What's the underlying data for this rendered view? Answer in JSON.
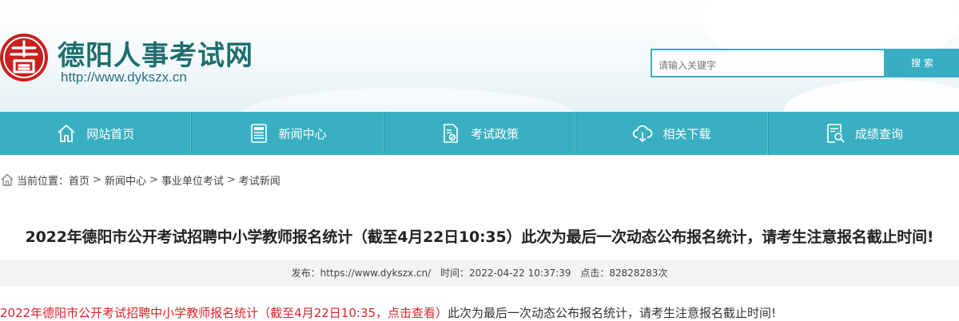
{
  "header": {
    "site_name": "德阳人事考试网",
    "site_url": "http://www.dykszx.cn",
    "logo_icon": "seal-logo-icon",
    "accent_color": "#38aec2",
    "logo_color": "#c8211e"
  },
  "search": {
    "placeholder": "请输入关键字",
    "button_label": "搜 索"
  },
  "nav": {
    "items": [
      {
        "label": "网站首页",
        "icon": "home-icon"
      },
      {
        "label": "新闻中心",
        "icon": "news-icon"
      },
      {
        "label": "考试政策",
        "icon": "policy-document-icon"
      },
      {
        "label": "相关下载",
        "icon": "cloud-download-icon"
      },
      {
        "label": "成绩查询",
        "icon": "search-document-icon"
      }
    ]
  },
  "breadcrumb": {
    "prefix": "当前位置：",
    "items": [
      "首页",
      "新闻中心",
      "事业单位考试",
      "考试新闻"
    ],
    "separator": ">"
  },
  "article": {
    "title": "2022年德阳市公开考试招聘中小学教师报名统计（截至4月22日10:35）此次为最后一次动态公布报名统计，请考生注意报名截止时间!",
    "meta": {
      "source_label": "发布：",
      "source": "https://www.dykszx.cn/",
      "time_label": "时间：",
      "time": "2022-04-22 10:37:39",
      "clicks_label": "点击：",
      "clicks": "82828283次"
    },
    "body_link": "2022年德阳市公开考试招聘中小学教师报名统计（截至4月22日10:35，点击查看）",
    "body_text": "此次为最后一次动态公布报名统计，请考生注意报名截止时间!"
  }
}
